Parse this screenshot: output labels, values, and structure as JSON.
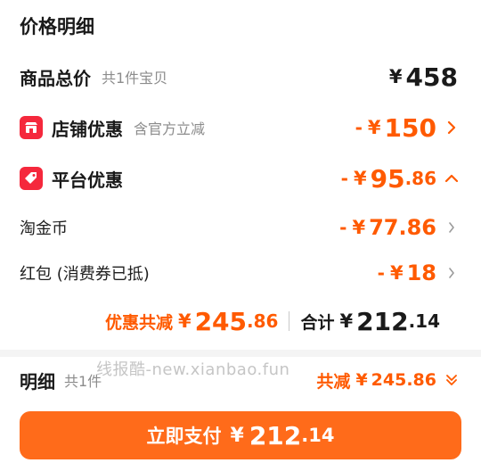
{
  "title": "价格明细",
  "currency": "¥",
  "colors": {
    "accent": "#ff5a00",
    "badge_red": "#f5283c",
    "button": "#ff6b1a"
  },
  "rows": {
    "total": {
      "label": "商品总价",
      "sub": "共1件宝贝",
      "amount": "458"
    },
    "shop": {
      "label": "店铺优惠",
      "sub": "含官方立减",
      "minus": "-",
      "amount": "150",
      "icon": "shop-icon",
      "chevron": "chevron-right-icon"
    },
    "platform": {
      "label": "平台优惠",
      "minus": "-",
      "amount_int": "95",
      "amount_dec": ".86",
      "icon": "tag-icon",
      "chevron": "chevron-up-icon"
    },
    "coins": {
      "label": "淘金币",
      "minus": "-",
      "amount": "77.86",
      "chevron": "chevron-right-icon"
    },
    "redpacket": {
      "label": "红包 (消费券已抵)",
      "minus": "-",
      "amount": "18",
      "chevron": "chevron-right-icon"
    }
  },
  "summary": {
    "discount_label": "优惠共减",
    "discount_int": "245",
    "discount_dec": ".86",
    "total_label": "合计",
    "total_int": "212",
    "total_dec": ".14"
  },
  "detail": {
    "label": "明细",
    "sub": "共1件",
    "reduce_label": "共减",
    "reduce_amount": "245.86",
    "chevron": "double-chevron-down-icon"
  },
  "watermark": "线报酷-new.xianbao.fun",
  "pay_button": {
    "label": "立即支付",
    "amount_int": "212",
    "amount_dec": ".14"
  }
}
